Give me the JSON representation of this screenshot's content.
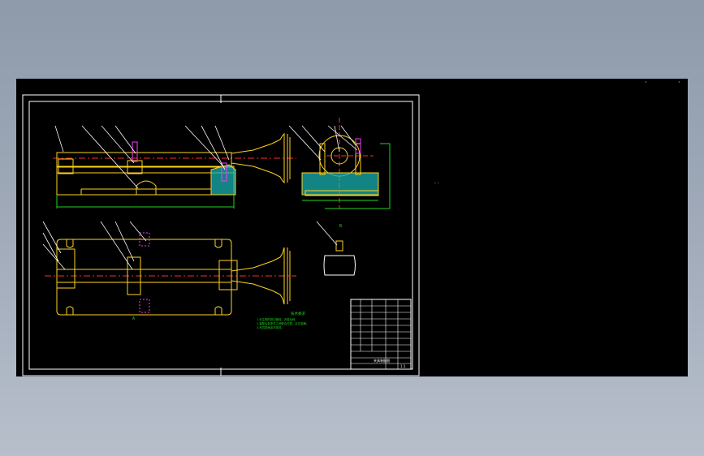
{
  "viewport": {
    "background": "#000000",
    "corner_marks": [
      "·",
      "·"
    ],
    "cursor_readout": "· ·"
  },
  "drawing": {
    "tech_requirements_title": "技术要求",
    "tech_requirements_lines": [
      "1.未注明的锐边倒钝，去除毛刺。",
      "2.装配后各零件之间配合可靠，定位准确。",
      "3.夹具表面涂防锈漆。"
    ],
    "view_label_top": "A",
    "view_label_side": "A-A",
    "detail_label": "B"
  },
  "title_block": {
    "name": "夹具装配图",
    "scale": "1:1"
  },
  "colors": {
    "frame": "#ffffff",
    "part": "#ffd21f",
    "centerline": "#ff2a2a",
    "dimension": "#22d422",
    "section_hatch": "#19b0b0",
    "highlight": "#ff33ff",
    "leader": "#ffffff"
  }
}
